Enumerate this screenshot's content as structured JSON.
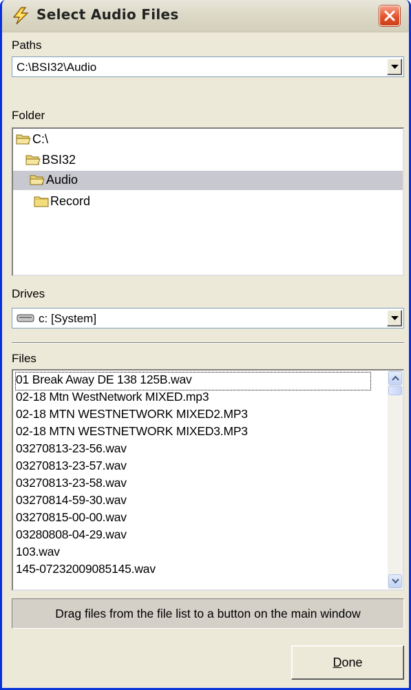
{
  "window": {
    "title": "Select Audio Files",
    "app_icon": "lightning-bolt-icon",
    "close_icon": "close-icon"
  },
  "paths": {
    "label": "Paths",
    "value": "C:\\BSI32\\Audio"
  },
  "folder": {
    "label": "Folder",
    "items": [
      {
        "label": "C:\\",
        "icon": "open-folder-icon"
      },
      {
        "label": "BSI32",
        "icon": "open-folder-icon"
      },
      {
        "label": "Audio",
        "icon": "open-folder-icon",
        "selected": true
      },
      {
        "label": "Record",
        "icon": "folder-icon"
      }
    ]
  },
  "drives": {
    "label": "Drives",
    "value": "c: [System]",
    "icon": "hard-drive-icon"
  },
  "files": {
    "label": "Files",
    "items": [
      "01 Break Away DE 138 125B.wav",
      "02-18 Mtn WestNetwork MIXED.mp3",
      "02-18 MTN WESTNETWORK MIXED2.MP3",
      "02-18 MTN WESTNETWORK MIXED3.MP3",
      "03270813-23-56.wav",
      "03270813-23-57.wav",
      "03270813-23-58.wav",
      "03270814-59-30.wav",
      "03270815-00-00.wav",
      "03280808-04-29.wav",
      "103.wav",
      "145-07232009085145.wav"
    ]
  },
  "hint": "Drag files from the file list to a button on the main window",
  "done_button": {
    "mnemonic": "D",
    "rest": "one"
  },
  "colors": {
    "window_bg": "#ece9d8",
    "selection_bg": "#c8c8d0",
    "close_red": "#e3542e",
    "border_blue": "#0831d9"
  }
}
